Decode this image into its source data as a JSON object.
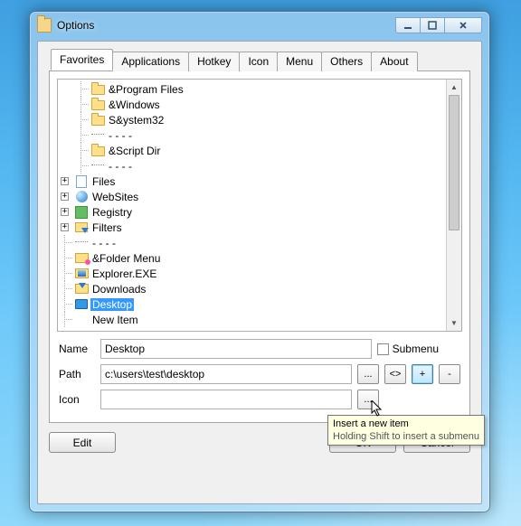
{
  "window": {
    "title": "Options"
  },
  "tabs": [
    "Favorites",
    "Applications",
    "Hotkey",
    "Icon",
    "Menu",
    "Others",
    "About"
  ],
  "active_tab": 0,
  "tree": {
    "items": [
      {
        "depth": 1,
        "icon": "folder",
        "label": "&Program Files"
      },
      {
        "depth": 1,
        "icon": "folder",
        "label": "&Windows"
      },
      {
        "depth": 1,
        "icon": "folder",
        "label": "S&ystem32"
      },
      {
        "depth": 1,
        "icon": "sep",
        "label": "- - - -"
      },
      {
        "depth": 1,
        "icon": "folder",
        "label": "&Script Dir"
      },
      {
        "depth": 1,
        "icon": "sep",
        "label": "- - - -"
      },
      {
        "depth": 0,
        "icon": "page",
        "expando": "+",
        "label": "Files"
      },
      {
        "depth": 0,
        "icon": "globe",
        "expando": "+",
        "label": "WebSites"
      },
      {
        "depth": 0,
        "icon": "reg",
        "expando": "+",
        "label": "Registry"
      },
      {
        "depth": 0,
        "icon": "filter",
        "expando": "+",
        "label": "Filters"
      },
      {
        "depth": 0,
        "icon": "sep",
        "label": "- - - -"
      },
      {
        "depth": 0,
        "icon": "foldermenu",
        "label": "&Folder Menu"
      },
      {
        "depth": 0,
        "icon": "explorer",
        "label": "Explorer.EXE"
      },
      {
        "depth": 0,
        "icon": "dl",
        "label": "Downloads"
      },
      {
        "depth": 0,
        "icon": "desktop",
        "label": "Desktop",
        "selected": true
      },
      {
        "depth": 0,
        "icon": "blank",
        "label": "New Item"
      }
    ]
  },
  "form": {
    "name_label": "Name",
    "name_value": "Desktop",
    "submenu_label": "Submenu",
    "submenu_checked": false,
    "path_label": "Path",
    "path_value": "c:\\users\\test\\desktop",
    "icon_label": "Icon",
    "icon_value": "",
    "browse_label": "...",
    "swap_label": "<>",
    "add_label": "+",
    "remove_label": "-"
  },
  "buttons": {
    "edit": "Edit",
    "ok": "OK",
    "cancel": "Cancel"
  },
  "tooltip": {
    "line1": "Insert a new item",
    "line2": "Holding Shift to insert a submenu"
  }
}
